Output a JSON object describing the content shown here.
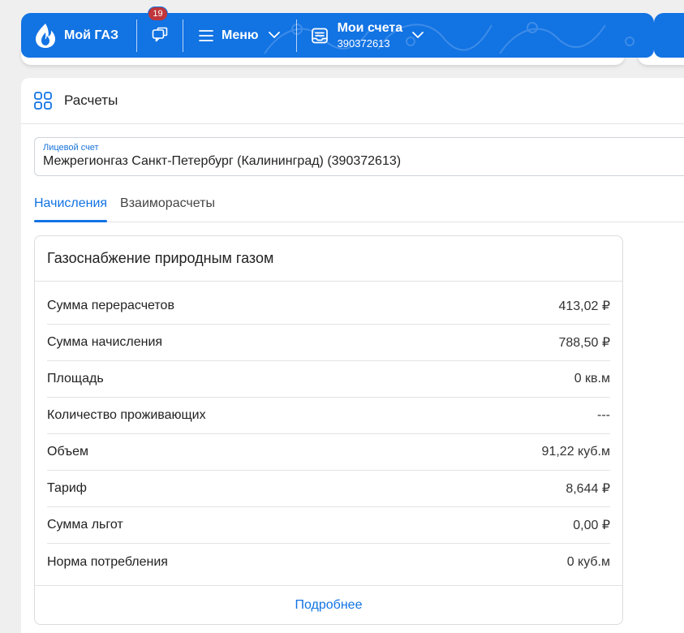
{
  "header": {
    "brand": "Мой ГАЗ",
    "notifications_count": "19",
    "menu_label": "Меню",
    "accounts_title": "Мои счета",
    "accounts_number": "390372613"
  },
  "page": {
    "title": "Расчеты"
  },
  "account_field": {
    "label": "Лицевой счет",
    "value": "Межрегионгаз Санкт-Петербург (Калининград) (390372613)"
  },
  "tabs": [
    {
      "label": "Начисления",
      "active": true
    },
    {
      "label": "Взаиморасчеты",
      "active": false
    }
  ],
  "card": {
    "title": "Газоснабжение природным газом",
    "rows": [
      {
        "label": "Сумма перерасчетов",
        "value": "413,02 ₽"
      },
      {
        "label": "Сумма начисления",
        "value": "788,50 ₽"
      },
      {
        "label": "Площадь",
        "value": "0 кв.м"
      },
      {
        "label": "Количество проживающих",
        "value": "---"
      },
      {
        "label": "Объем",
        "value": "91,22 куб.м"
      },
      {
        "label": "Тариф",
        "value": "8,644 ₽"
      },
      {
        "label": "Сумма льгот",
        "value": "0,00 ₽"
      },
      {
        "label": "Норма потребления",
        "value": "0 куб.м"
      }
    ],
    "more_link": "Подробнее"
  },
  "colors": {
    "brand_blue": "#1273e3",
    "badge_red": "#c0363a"
  },
  "icons": [
    "gas-flame-logo-icon",
    "chat-icon",
    "hamburger-icon",
    "chevron-down-icon",
    "accounts-inbox-icon",
    "grid-apps-icon"
  ]
}
